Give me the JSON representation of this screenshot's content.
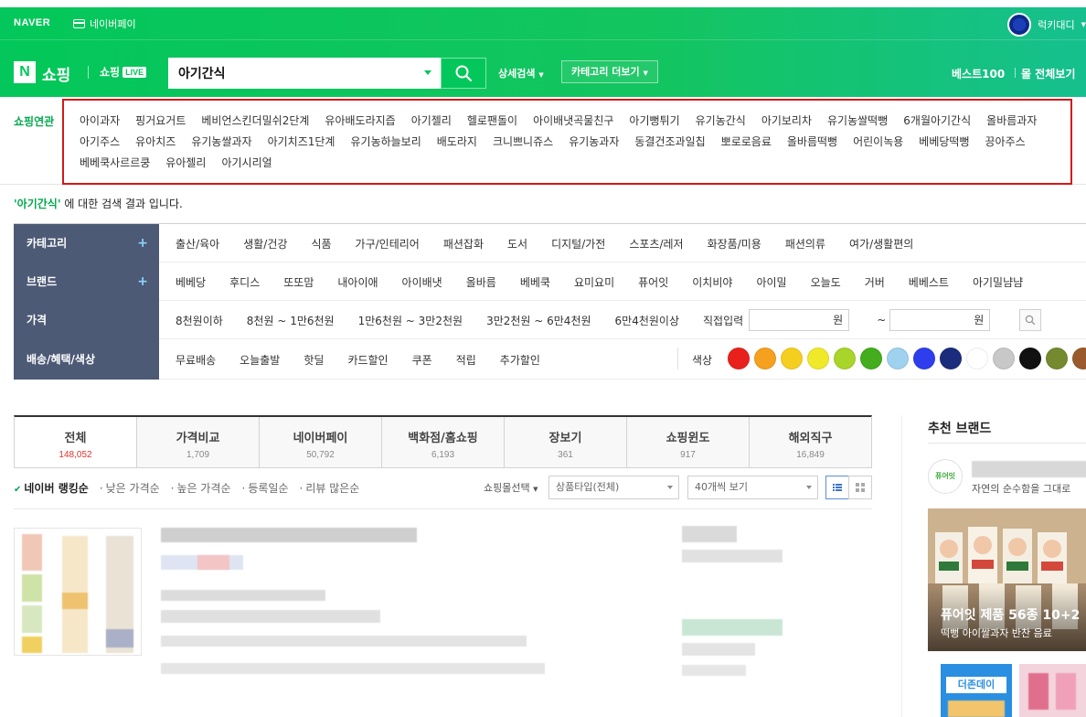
{
  "gnb": {
    "naver_logo": "NAVER",
    "naver_pay": "네이버페이",
    "user_name": "럭키대디",
    "shopping_logo_n": "N",
    "shopping_logo": "쇼핑",
    "live_logo": "쇼핑",
    "live_badge": "LIVE",
    "search_value": "아기간식",
    "detail_search": "상세검색",
    "category_more": "카테고리 더보기",
    "best100": "베스트100",
    "all_view": "몰 전체보기"
  },
  "related": {
    "label": "쇼핑연관",
    "keywords": [
      "아이과자",
      "핑거요거트",
      "베비언스킨더밀쉬2단계",
      "유아배도라지즙",
      "아기젤리",
      "헬로팬돌이",
      "아이배냇곡물친구",
      "아기뻥튀기",
      "유기농간식",
      "아기보리차",
      "유기농쌀떡뻥",
      "6개월아기간식",
      "올바름과자",
      "아기주스",
      "유아치즈",
      "유기농쌀과자",
      "아기치즈1단계",
      "유기농하늘보리",
      "배도라지",
      "크니쁘니쥬스",
      "유기농과자",
      "동결건조과일칩",
      "뽀로로음료",
      "올바름떡뻥",
      "어린이녹용",
      "베베당떡뻥",
      "끙아주스",
      "베베쿡사르르쿵",
      "유아젤리",
      "아기시리얼"
    ]
  },
  "result": {
    "keyword": "'아기간식'",
    "suffix": " 에 대한 검색 결과 입니다."
  },
  "filters": {
    "category": {
      "label": "카테고리",
      "plus": "+",
      "items": [
        "출산/육아",
        "생활/건강",
        "식품",
        "가구/인테리어",
        "패션잡화",
        "도서",
        "디지털/가전",
        "스포츠/레저",
        "화장품/미용",
        "패션의류",
        "여가/생활편의"
      ]
    },
    "brand": {
      "label": "브랜드",
      "plus": "+",
      "items": [
        "베베당",
        "후디스",
        "또또맘",
        "내아이애",
        "아이배냇",
        "올바름",
        "베베쿡",
        "요미요미",
        "퓨어잇",
        "이치비야",
        "아이밀",
        "오늘도",
        "거버",
        "베베스트",
        "아기밀냠냠"
      ]
    },
    "price": {
      "label": "가격",
      "items": [
        "8천원이하",
        "8천원 ~ 1만6천원",
        "1만6천원 ~ 3만2천원",
        "3만2천원 ~ 6만4천원",
        "6만4천원이상"
      ],
      "direct": "직접입력",
      "unit": "원",
      "tilde": "~"
    },
    "delivery": {
      "label": "배송/혜택/색상",
      "items": [
        "무료배송",
        "오늘출발",
        "핫딜",
        "카드할인",
        "쿠폰",
        "적립",
        "추가할인"
      ],
      "color_label": "색상"
    }
  },
  "swatch_colors": [
    "#e8211c",
    "#f5a01e",
    "#f5cf1f",
    "#f0e92a",
    "#a9d42a",
    "#43ad1e",
    "#9fd2ee",
    "#2f3eec",
    "#1c2c7c",
    "#ffffff",
    "#c8c8c8",
    "#111111",
    "#758a2f",
    "#9b5a2c",
    "#8a2ac7"
  ],
  "tabs": [
    {
      "label": "전체",
      "count": "148,052"
    },
    {
      "label": "가격비교",
      "count": "1,709"
    },
    {
      "label": "네이버페이",
      "count": "50,792"
    },
    {
      "label": "백화점/홈쇼핑",
      "count": "6,193"
    },
    {
      "label": "장보기",
      "count": "361"
    },
    {
      "label": "쇼핑윈도",
      "count": "917"
    },
    {
      "label": "해외직구",
      "count": "16,849"
    }
  ],
  "sort": {
    "ranking": "네이버 랭킹순",
    "low_price": "낮은 가격순",
    "high_price": "높은 가격순",
    "registered": "등록일순",
    "reviews": "리뷰 많은순",
    "mall_select": "쇼핑몰선택",
    "product_type": "상품타입(전체)",
    "per_page": "40개씩 보기"
  },
  "side": {
    "title": "추천 브랜드",
    "brand_logo": "퓨어잇",
    "brand_desc": "자연의 순수함을 그대로",
    "banner_title": "퓨어잇 제품 56종 10+2",
    "banner_sub": "떡뻥 아이쌀과자 반찬 음료",
    "card_label": "더존데이"
  }
}
